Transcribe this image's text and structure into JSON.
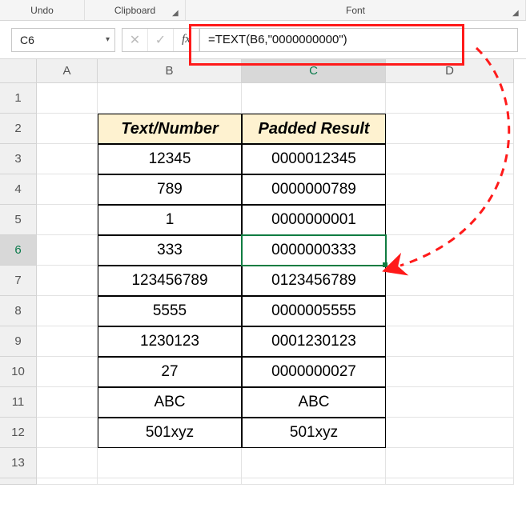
{
  "ribbon": {
    "undo": "Undo",
    "clipboard": "Clipboard",
    "font": "Font"
  },
  "formula_bar": {
    "cell_ref": "C6",
    "formula": "=TEXT(B6,\"0000000000\")"
  },
  "columns": [
    "A",
    "B",
    "C",
    "D"
  ],
  "rows": [
    "1",
    "2",
    "3",
    "4",
    "5",
    "6",
    "7",
    "8",
    "9",
    "10",
    "11",
    "12",
    "13"
  ],
  "active": {
    "col": "C",
    "row": "6"
  },
  "headers": {
    "b": "Text/Number",
    "c": "Padded Result"
  },
  "data": [
    {
      "b": "12345",
      "c": "0000012345"
    },
    {
      "b": "789",
      "c": "0000000789"
    },
    {
      "b": "1",
      "c": "0000000001"
    },
    {
      "b": "333",
      "c": "0000000333"
    },
    {
      "b": "123456789",
      "c": "0123456789"
    },
    {
      "b": "5555",
      "c": "0000005555"
    },
    {
      "b": "1230123",
      "c": "0001230123"
    },
    {
      "b": "27",
      "c": "0000000027"
    },
    {
      "b": "ABC",
      "c": "ABC"
    },
    {
      "b": "501xyz",
      "c": "501xyz"
    }
  ]
}
